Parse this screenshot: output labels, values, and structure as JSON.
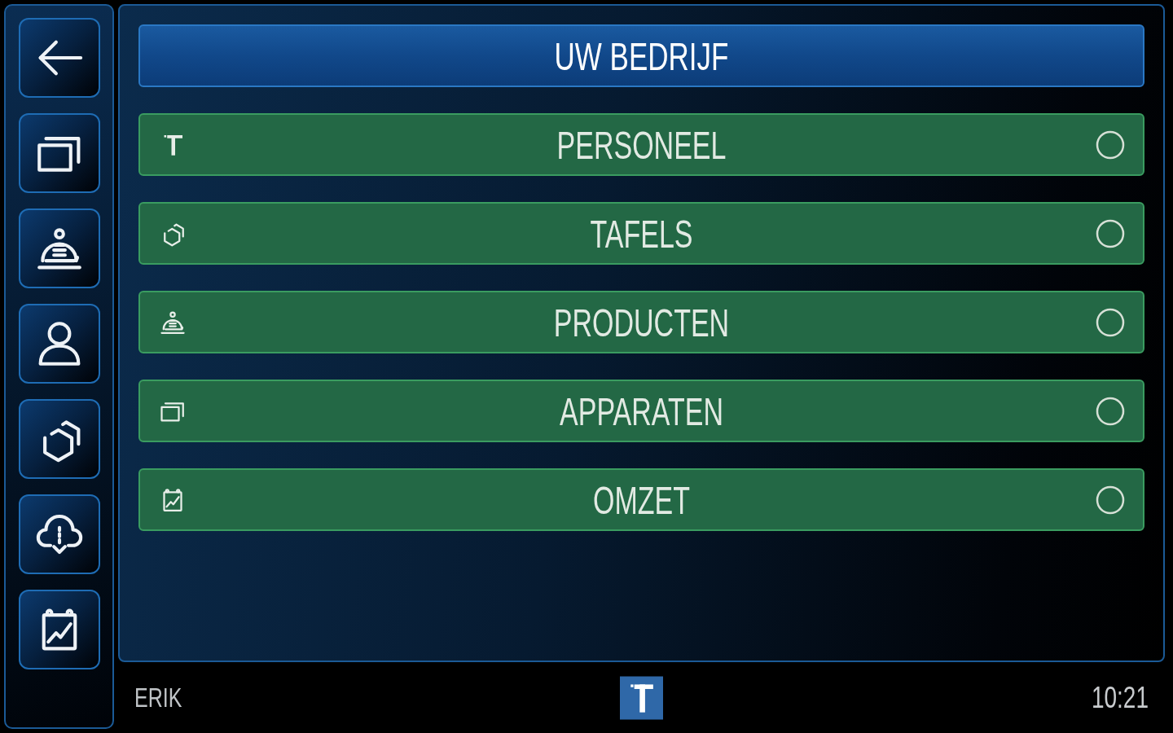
{
  "sidebar": {
    "buttons": [
      {
        "kind": "back"
      },
      {
        "kind": "windows"
      },
      {
        "kind": "bell"
      },
      {
        "kind": "person"
      },
      {
        "kind": "hexagons"
      },
      {
        "kind": "cloud-download"
      },
      {
        "kind": "calendar-chart"
      }
    ]
  },
  "header": {
    "title": "UW BEDRIJF"
  },
  "menu": {
    "items": [
      {
        "kind": "logo",
        "label": "PERSONEEL",
        "selected": false
      },
      {
        "kind": "hexagons",
        "label": "TAFELS",
        "selected": false
      },
      {
        "kind": "bell",
        "label": "PRODUCTEN",
        "selected": false
      },
      {
        "kind": "windows",
        "label": "APPARATEN",
        "selected": false
      },
      {
        "kind": "calendar-chart",
        "label": "OMZET",
        "selected": false
      }
    ]
  },
  "status_bar": {
    "user": "ERIK",
    "time": "10:21"
  }
}
